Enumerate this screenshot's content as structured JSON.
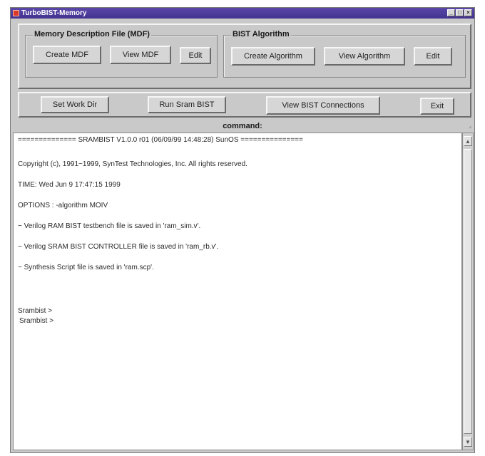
{
  "window": {
    "title": "TurboBIST-Memory",
    "controls": [
      "_",
      "□",
      "×"
    ]
  },
  "mdf_group": {
    "label": "Memory Description File (MDF)",
    "buttons": [
      "Create MDF",
      "View MDF",
      "Edit"
    ]
  },
  "algorithm_group": {
    "label": "BIST Algorithm",
    "buttons": [
      "Create Algorithm",
      "View Algorithm",
      "Edit"
    ]
  },
  "toolbar": {
    "buttons": [
      "Set Work Dir",
      "Run Sram BIST",
      "View BIST Connections",
      "Exit"
    ]
  },
  "command": {
    "label": "command:"
  },
  "output": {
    "lines": [
      "============== SRAMBIST V1.0.0 r01 (06/09/99 14:48:28) SunOS ===============",
      "Copyright (c), 1991~1999, SynTest Technologies, Inc. All rights reserved.",
      "TIME: Wed Jun 9 17:47:15 1999",
      "OPTIONS : -algorithm MOIV",
      "~ Verilog RAM BIST testbench file is saved in 'ram_sim.v'.",
      "~ Verilog SRAM BIST CONTROLLER file is saved in 'ram_rb.v'.",
      "~ Synthesis Script file is saved in 'ram.scp'.",
      "Srambist >",
      "Srambist >"
    ]
  },
  "colors": {
    "titlebar": "#43338f",
    "panel": "#c9c9c9",
    "output_bg": "#ffffff"
  },
  "icons": {
    "app": "app-icon",
    "scroll_up": "scroll-up-icon",
    "scroll_down": "scroll-down-icon"
  }
}
